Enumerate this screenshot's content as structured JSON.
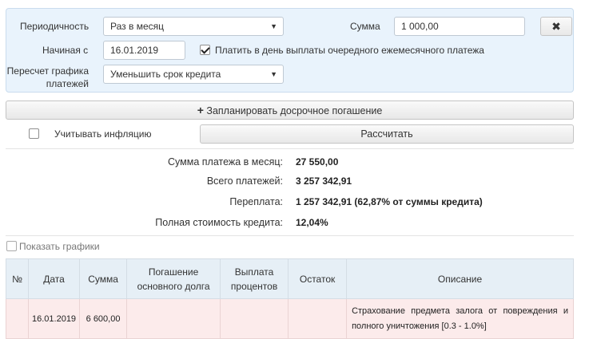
{
  "form": {
    "periodicity_label": "Периодичность",
    "periodicity_value": "Раз в месяц",
    "sum_label": "Сумма",
    "sum_value": "1 000,00",
    "start_label": "Начиная с",
    "start_value": "16.01.2019",
    "pay_on_day_label": "Платить в день выплаты очередного ежемесячного платежа",
    "pay_on_day_checked": true,
    "recalc_label_line1": "Пересчет графика",
    "recalc_label_line2": "платежей",
    "recalc_value": "Уменьшить срок кредита",
    "close_icon": "close-x-icon"
  },
  "actions": {
    "plan_early_label": "Запланировать досрочное погашение",
    "plan_icon": "plus-icon",
    "inflation_label": "Учитывать инфляцию",
    "inflation_checked": false,
    "calculate_label": "Рассчитать"
  },
  "results": [
    {
      "label": "Сумма платежа в месяц:",
      "value": "27 550,00"
    },
    {
      "label": "Всего платежей:",
      "value": "3 257 342,91"
    },
    {
      "label": "Переплата:",
      "value": "1 257 342,91 (62,87% от суммы кредита)"
    },
    {
      "label": "Полная стоимость кредита:",
      "value": "12,04%"
    }
  ],
  "show_charts": {
    "label": "Показать графики",
    "checked": false
  },
  "table": {
    "headers": [
      "№",
      "Дата",
      "Сумма",
      "Погашение основного долга",
      "Выплата процентов",
      "Остаток",
      "Описание"
    ],
    "rows": [
      {
        "num": "",
        "date": "16.01.2019",
        "sum": "6 600,00",
        "principal": "",
        "interest": "",
        "balance": "",
        "description": "Страхование предмета залога от повреждения и полного уничтожения [0.3 - 1.0%]"
      }
    ]
  }
}
